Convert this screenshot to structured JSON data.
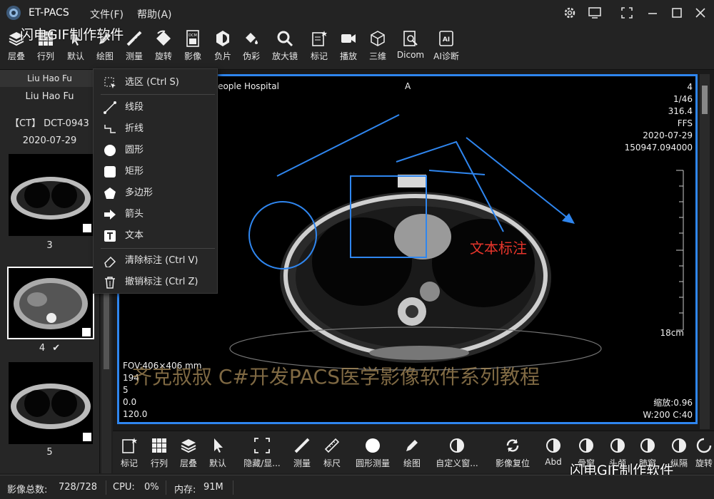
{
  "app": {
    "title": "ET-PACS",
    "menus": [
      "文件(F)",
      "帮助(A)"
    ]
  },
  "watermark": {
    "top": "闪电GIF制作软件",
    "bottom": "闪电GIF制作软件",
    "center": "齐克叔叔 C#开发PACS医学影像软件系列教程"
  },
  "toolbar": [
    "层叠",
    "行列",
    "默认",
    "绘图",
    "测量",
    "旋转",
    "影像",
    "负片",
    "伪彩",
    "放大镜",
    "标记",
    "播放",
    "三维",
    "Dicom",
    "AI诊断"
  ],
  "sidebar": {
    "header": "Liu Hao Fu",
    "patient_name": "Liu Hao Fu",
    "patient_id": "【CT】 DCT-0943",
    "date": "2020-07-29",
    "thumbnails": [
      {
        "label": "3",
        "checked": false
      },
      {
        "label": "4",
        "checked": true,
        "check_icon": "✔"
      },
      {
        "label": "5",
        "checked": false
      }
    ]
  },
  "draw_menu": [
    {
      "icon": "select-region-icon",
      "label": "选区 (Ctrl S)"
    },
    {
      "icon": "line-icon",
      "label": "线段"
    },
    {
      "icon": "polyline-icon",
      "label": "折线"
    },
    {
      "icon": "circle-icon",
      "label": "圆形"
    },
    {
      "icon": "rectangle-icon",
      "label": "矩形"
    },
    {
      "icon": "polygon-icon",
      "label": "多边形"
    },
    {
      "icon": "arrow-icon",
      "label": "箭头"
    },
    {
      "icon": "text-icon",
      "label": "文本"
    },
    {
      "icon": "eraser-icon",
      "label": "清除标注 (Ctrl V)"
    },
    {
      "icon": "trash-icon",
      "label": "撤销标注 (Ctrl Z)"
    }
  ],
  "viewer": {
    "hospital": ".1 People Hospital",
    "orientation_top": "A",
    "info_right": [
      "4",
      "1/46",
      "316.4",
      "FFS",
      "2020-07-29",
      "150947.094000"
    ],
    "info_left_bottom": [
      "FOV:406×406 mm",
      "194",
      "5",
      "0.0",
      "120.0"
    ],
    "scale": "18cm",
    "zoom": "缩放:0.96",
    "window": "W:200 C:40",
    "text_annotation": "文本标注"
  },
  "bottom_tools": [
    "标记",
    "行列",
    "层叠",
    "默认",
    "隐藏/显...",
    "测量",
    "标尺",
    "圆形测量",
    "绘图",
    "自定义窗...",
    "影像复位",
    "Abd",
    "骨窗",
    "头颅",
    "肺窗",
    "纵隔",
    "旋转"
  ],
  "status": {
    "image_count_label": "影像总数:",
    "image_count": "728/728",
    "cpu_label": "CPU:",
    "cpu": "0%",
    "mem_label": "内存:",
    "mem": "91M"
  },
  "colors": {
    "accent": "#2f86ef",
    "annotation_text": "#e8352b",
    "background": "#1f1f1f"
  }
}
